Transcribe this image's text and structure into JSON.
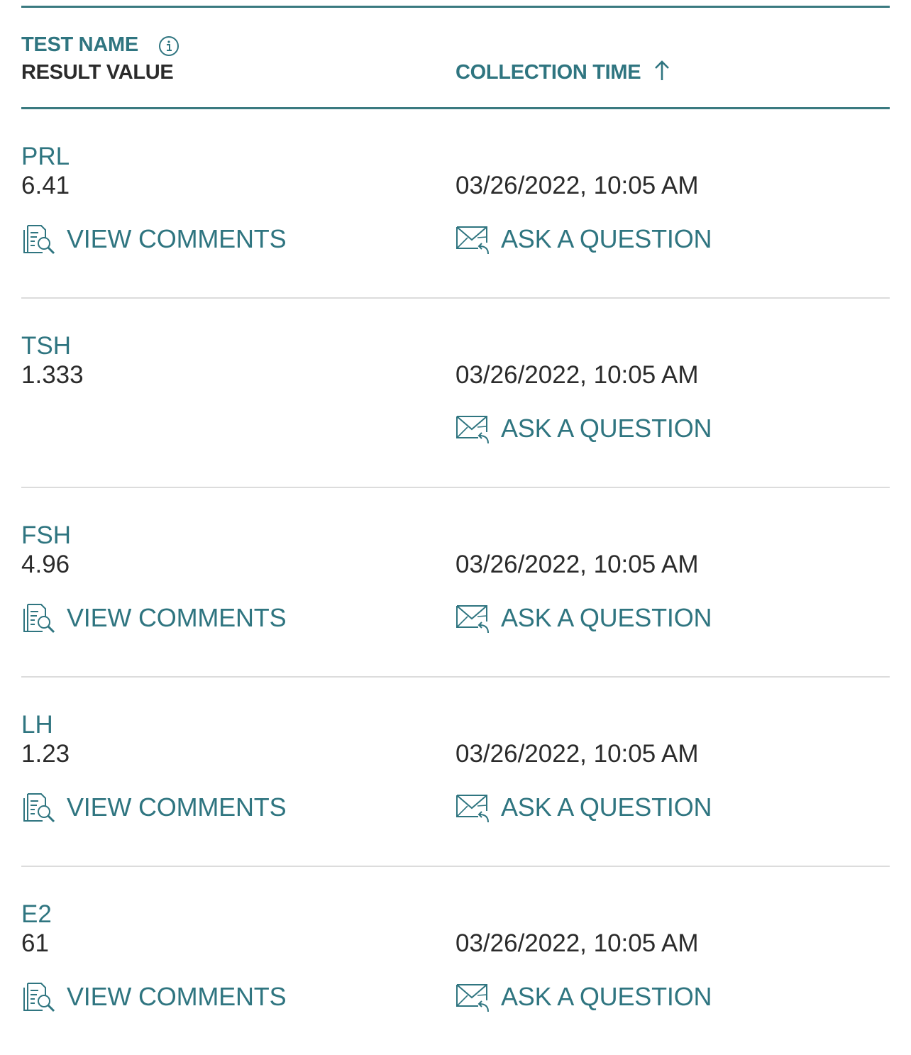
{
  "header": {
    "test_name_label": "TEST NAME",
    "result_value_label": "RESULT VALUE",
    "collection_time_label": "COLLECTION TIME",
    "info_icon": "info-icon",
    "sort_icon": "arrow-up-icon"
  },
  "actions": {
    "view_comments_label": "VIEW COMMENTS",
    "ask_question_label": "ASK A QUESTION",
    "view_comments_icon": "document-search-icon",
    "ask_question_icon": "envelope-reply-icon"
  },
  "colors": {
    "accent": "#2f7580",
    "text": "#2b2b2b",
    "divider": "#dcdcdc"
  },
  "results": [
    {
      "test_name": "PRL",
      "result_value": "6.41",
      "collection_time": "03/26/2022, 10:05 AM",
      "has_comments": true
    },
    {
      "test_name": "TSH",
      "result_value": "1.333",
      "collection_time": "03/26/2022, 10:05 AM",
      "has_comments": false
    },
    {
      "test_name": "FSH",
      "result_value": "4.96",
      "collection_time": "03/26/2022, 10:05 AM",
      "has_comments": true
    },
    {
      "test_name": "LH",
      "result_value": "1.23",
      "collection_time": "03/26/2022, 10:05 AM",
      "has_comments": true
    },
    {
      "test_name": "E2",
      "result_value": "61",
      "collection_time": "03/26/2022, 10:05 AM",
      "has_comments": true
    }
  ]
}
